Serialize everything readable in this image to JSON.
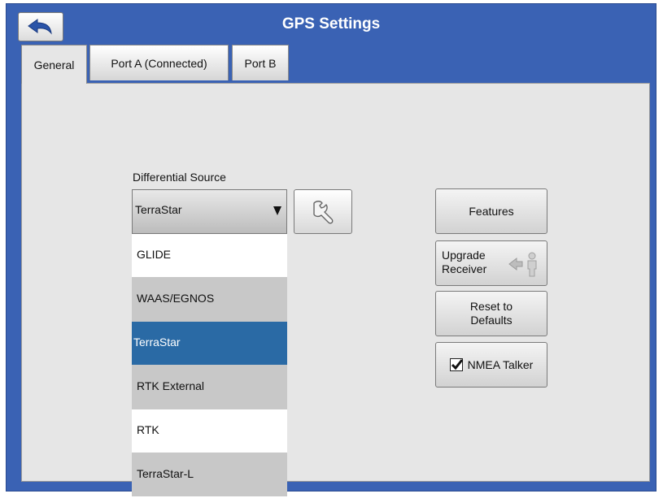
{
  "window": {
    "title": "GPS Settings"
  },
  "tabs": [
    {
      "label": "General",
      "active": true
    },
    {
      "label": "Port A (Connected)",
      "active": false
    },
    {
      "label": "Port B",
      "active": false
    }
  ],
  "differential_source": {
    "label": "Differential Source",
    "selected": "TerraStar",
    "options": [
      "GLIDE",
      "WAAS/EGNOS",
      "TerraStar",
      "RTK External",
      "RTK",
      "TerraStar-L"
    ]
  },
  "buttons": {
    "features": "Features",
    "upgrade_receiver_line1": "Upgrade",
    "upgrade_receiver_line2": "Receiver",
    "reset_line1": "Reset to",
    "reset_line2": "Defaults",
    "nmea_talker": "NMEA Talker",
    "nmea_talker_checked": true
  },
  "icons": {
    "back": "back-arrow-icon",
    "wrench": "wrench-icon",
    "upgrade": "person-arrow-icon",
    "dropdown": "dropdown-arrow-icon",
    "checkmark": "checkmark-icon"
  },
  "colors": {
    "window_background": "#3a62b4",
    "content_background": "#e6e6e6",
    "selected_item": "#2a6aa5"
  }
}
